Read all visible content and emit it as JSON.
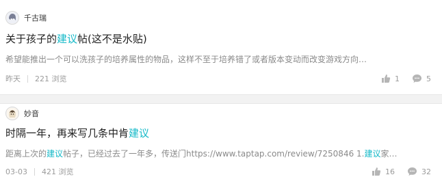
{
  "posts": [
    {
      "author": "千古瑞",
      "title_pre": "关于孩子的",
      "title_hl": "建议",
      "title_post": "帖(这不是水贴)",
      "summary": "希望能推出一个可以洗孩子的培养属性的物品，这样不至于培养错了或者版本变动而改变游戏方向…",
      "time": "昨天",
      "views": "221 浏览",
      "likes": "1",
      "comments": "5"
    },
    {
      "author": "妙音",
      "title_pre": "时隔一年，再来写几条中肯",
      "title_hl": "建议",
      "title_post": "",
      "summary_pre": "距离上次的",
      "summary_hl1": "建议",
      "summary_mid": "帖子，已经过去了一年多，传送门https://www.taptap.com/review/7250846 1.",
      "summary_hl2": "建议",
      "summary_post": "家…",
      "time": "03-03",
      "views": "421 浏览",
      "likes": "16",
      "comments": "32"
    }
  ],
  "colors": {
    "highlight": "#14b9c8",
    "meta": "#9b9b9b",
    "summary": "#8a8a8a"
  },
  "icons": [
    "avatar-icon",
    "thumbs-up-icon",
    "comment-icon"
  ]
}
